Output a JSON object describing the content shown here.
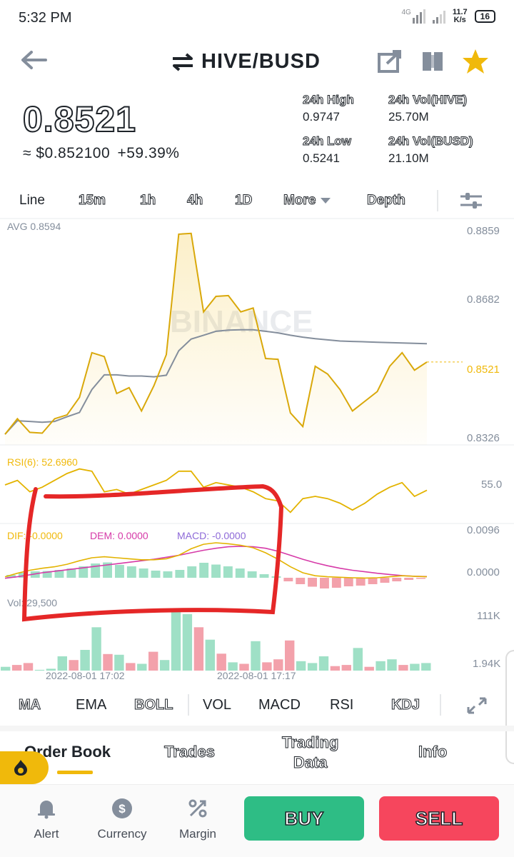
{
  "status": {
    "time": "5:32 PM",
    "network": "4G",
    "speed_value": "11.7",
    "speed_unit": "K/s",
    "battery": "16"
  },
  "header": {
    "pair": "HIVE/BUSD",
    "icons": [
      "back-arrow-icon",
      "swap-icon",
      "share-icon",
      "book-icon",
      "star-icon"
    ]
  },
  "ticker": {
    "price": "0.8521",
    "sub_price": "≈ $0.852100",
    "change": "+59.39%",
    "high_label": "24h High",
    "high": "0.9747",
    "low_label": "24h Low",
    "low": "0.5241",
    "vol_hive_label": "24h Vol(HIVE)",
    "vol_hive": "25.70M",
    "vol_busd_label": "24h Vol(BUSD)",
    "vol_busd": "21.10M"
  },
  "intervals": {
    "line": "Line",
    "m15": "15m",
    "h1": "1h",
    "h4": "4h",
    "d1": "1D",
    "more": "More",
    "depth": "Depth"
  },
  "colors": {
    "accent": "#f0b90b",
    "up": "#2ebd85",
    "down": "#f6465d",
    "up_bar": "#9fe0c6",
    "down_bar": "#f3a1ab",
    "macd_dem": "#d63aa8"
  },
  "chart_data": [
    {
      "type": "line",
      "title": "",
      "avg_label": "AVG 0.8594",
      "watermark": "BINANCE",
      "yticks": [
        "0.8859",
        "0.8682",
        "0.8521",
        "0.8326"
      ],
      "ylim": [
        0.8326,
        0.8859
      ],
      "series": [
        {
          "name": "price",
          "values": [
            0.8335,
            0.8375,
            0.834,
            0.8338,
            0.8375,
            0.8385,
            0.843,
            0.8545,
            0.8535,
            0.844,
            0.8455,
            0.8395,
            0.846,
            0.854,
            0.885,
            0.8852,
            0.865,
            0.869,
            0.8692,
            0.865,
            0.866,
            0.853,
            0.8528,
            0.839,
            0.8355,
            0.851,
            0.849,
            0.845,
            0.8395,
            0.842,
            0.8445,
            0.851,
            0.8545,
            0.85,
            0.8521
          ]
        },
        {
          "name": "avg",
          "values": [
            0.8335,
            0.837,
            0.8368,
            0.8366,
            0.8368,
            0.838,
            0.8391,
            0.845,
            0.8488,
            0.8488,
            0.8485,
            0.8485,
            0.8483,
            0.8487,
            0.855,
            0.858,
            0.859,
            0.86,
            0.8603,
            0.8604,
            0.8604,
            0.86,
            0.8596,
            0.859,
            0.8585,
            0.8581,
            0.8578,
            0.8575,
            0.8574,
            0.8573,
            0.8572,
            0.8571,
            0.857,
            0.8569,
            0.8568
          ]
        }
      ]
    },
    {
      "type": "line",
      "title": "",
      "label": "RSI(6): 52.6960",
      "ytick": "55.0",
      "series": [
        {
          "name": "RSI(6)",
          "values": [
            55,
            57,
            52,
            54,
            57,
            60,
            62,
            61,
            52,
            53,
            51,
            53,
            55,
            57,
            61,
            61,
            54,
            56,
            55,
            54,
            52,
            49,
            48,
            43,
            49,
            50,
            49,
            47,
            44,
            47,
            51,
            54,
            56,
            50,
            52.7
          ]
        }
      ]
    },
    {
      "type": "bar",
      "title": "",
      "labels": {
        "dif": "DIF: -0.0000",
        "dem": "DEM: 0.0000",
        "macd": "MACD: -0.0000"
      },
      "yticks": [
        "0.0096",
        "0.0000"
      ],
      "values": [
        0.8,
        1.4,
        1.8,
        1.9,
        2.2,
        2.6,
        3.2,
        4.0,
        4.3,
        3.6,
        3.2,
        2.6,
        2.0,
        1.8,
        2.2,
        3.2,
        4.2,
        3.7,
        3.2,
        2.6,
        1.8,
        1.0,
        0.4,
        -1.0,
        -1.8,
        -2.5,
        -3.0,
        -2.8,
        -2.4,
        -2.2,
        -1.8,
        -1.4,
        -1.0,
        -0.6,
        -0.3
      ],
      "series": [
        {
          "name": "DIF",
          "values": [
            0.4,
            1.8,
            3.0,
            3.8,
            4.4,
            5.4,
            6.8,
            8.0,
            8.4,
            8.0,
            7.6,
            7.2,
            7.2,
            7.6,
            9.0,
            11.6,
            13.4,
            14.0,
            13.6,
            13.0,
            12.0,
            10.0,
            7.4,
            4.4,
            2.0,
            0.8,
            0.4,
            0.2,
            0.0,
            -0.1,
            0.0,
            0.4,
            0.8,
            0.6,
            0.4
          ]
        },
        {
          "name": "DEM",
          "values": [
            -0.2,
            0.4,
            1.2,
            2.0,
            2.6,
            3.2,
            3.8,
            4.4,
            5.0,
            5.6,
            6.2,
            6.8,
            7.4,
            8.2,
            9.0,
            10.0,
            11.0,
            11.8,
            12.4,
            12.6,
            12.4,
            11.8,
            10.6,
            9.0,
            7.4,
            6.0,
            4.8,
            3.8,
            3.0,
            2.4,
            1.8,
            1.3,
            0.9,
            0.6,
            0.5
          ]
        }
      ]
    },
    {
      "type": "bar",
      "title": "",
      "label": "Vol: 29,500",
      "yticks": [
        "111K",
        "1.94K"
      ],
      "values": [
        10,
        15,
        20,
        2,
        5,
        38,
        28,
        55,
        115,
        44,
        42,
        20,
        18,
        50,
        28,
        163,
        150,
        115,
        82,
        45,
        22,
        18,
        78,
        22,
        30,
        80,
        25,
        20,
        38,
        12,
        15,
        60,
        10,
        25,
        30,
        15,
        18,
        20
      ],
      "directions": [
        "up",
        "down",
        "down",
        "up",
        "up",
        "up",
        "down",
        "up",
        "up",
        "down",
        "up",
        "down",
        "up",
        "down",
        "up",
        "up",
        "up",
        "down",
        "up",
        "down",
        "up",
        "down",
        "up",
        "down",
        "down",
        "down",
        "up",
        "up",
        "up",
        "down",
        "down",
        "up",
        "down",
        "up",
        "up",
        "down",
        "up",
        "up"
      ],
      "x_ticks": [
        "2022-08-01 17:02",
        "2022-08-01 17:17"
      ]
    }
  ],
  "indicators": [
    "MA",
    "EMA",
    "BOLL",
    "VOL",
    "MACD",
    "RSI",
    "KDJ"
  ],
  "sections": {
    "order_book": "Order Book",
    "trades": "Trades",
    "trading_data_1": "Trading",
    "trading_data_2": "Data",
    "info": "Info"
  },
  "bottom_nav": {
    "alert": "Alert",
    "currency": "Currency",
    "margin": "Margin",
    "buy": "BUY",
    "sell": "SELL"
  }
}
